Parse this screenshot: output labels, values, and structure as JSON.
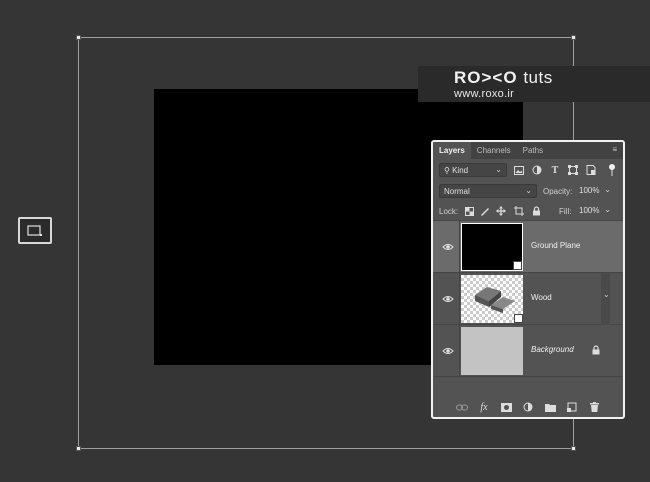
{
  "watermark": {
    "logo": "RO><O",
    "logo_suffix": "tuts",
    "url": "www.roxo.ir"
  },
  "tool": {
    "icon": "artboard-icon"
  },
  "layers_panel": {
    "tabs": [
      {
        "label": "Layers",
        "active": true
      },
      {
        "label": "Channels",
        "active": false
      },
      {
        "label": "Paths",
        "active": false
      }
    ],
    "filter": {
      "kind_label": "Kind",
      "icons": [
        "image-filter-icon",
        "adjustment-filter-icon",
        "type-filter-icon",
        "shape-filter-icon",
        "smart-object-filter-icon"
      ]
    },
    "blend_mode": "Normal",
    "opacity_label": "Opacity:",
    "opacity_value": "100%",
    "lock_label": "Lock:",
    "fill_label": "Fill:",
    "fill_value": "100%",
    "layers": [
      {
        "name": "Ground Plane",
        "thumb": "black",
        "selected": true,
        "smart_object": true
      },
      {
        "name": "Wood",
        "thumb": "checker",
        "selected": false,
        "smart_object": true
      },
      {
        "name": "Background",
        "thumb": "gray",
        "selected": false,
        "locked": true
      }
    ],
    "footer_icons": [
      "link-icon",
      "fx-icon",
      "mask-icon",
      "adjustment-icon",
      "folder-icon",
      "new-layer-icon",
      "trash-icon"
    ]
  },
  "colors": {
    "workspace": "#353535",
    "panel": "#535353",
    "selected_layer": "#6b6b6b"
  }
}
